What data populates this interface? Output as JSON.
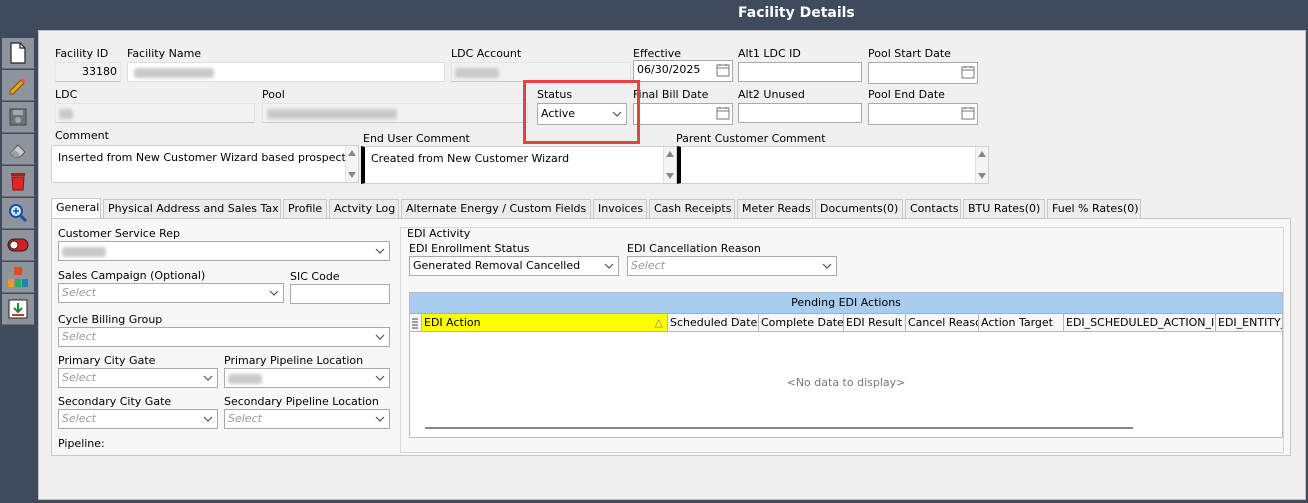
{
  "window": {
    "title": "Facility Details"
  },
  "toolbar": {
    "items": [
      {
        "icon": "new-document-icon"
      },
      {
        "icon": "pencil-icon"
      },
      {
        "icon": "save-icon"
      },
      {
        "icon": "eraser-icon"
      },
      {
        "icon": "delete-icon"
      },
      {
        "icon": "search-zoom-icon"
      },
      {
        "icon": "toggle-icon"
      },
      {
        "icon": "org-chart-icon"
      },
      {
        "icon": "import-icon"
      }
    ]
  },
  "header": {
    "facility_id_label": "Facility ID",
    "facility_id_value": "33180",
    "facility_name_label": "Facility Name",
    "ldc_account_label": "LDC Account",
    "effective_label": "Effective",
    "effective_value": "06/30/2025",
    "alt1_label": "Alt1  LDC ID",
    "pool_start_label": "Pool Start Date",
    "ldc_label": "LDC",
    "pool_label": "Pool",
    "status_label": "Status",
    "status_value": "Active",
    "final_bill_label": "Final Bill Date",
    "alt2_label": "Alt2  Unused",
    "pool_end_label": "Pool End Date",
    "comment_label": "Comment",
    "comment_value": "Inserted from New Customer Wizard based prospect",
    "end_user_comment_label": "End User Comment",
    "end_user_comment_value": "Created from New Customer Wizard",
    "parent_comment_label": "Parent Customer Comment"
  },
  "tabs": [
    "General",
    "Physical Address and Sales Tax",
    "Profile",
    "Actvity Log",
    "Alternate Energy / Custom Fields",
    "Invoices",
    "Cash Receipts",
    "Meter Reads",
    "Documents(0)",
    "Contacts",
    "BTU Rates(0)",
    "Fuel % Rates(0)"
  ],
  "general": {
    "csr_label": "Customer Service Rep",
    "sales_campaign_label": "Sales Campaign (Optional)",
    "sales_campaign_placeholder": "Select",
    "sic_label": "SIC Code",
    "cycle_label": "Cycle Billing Group",
    "cycle_placeholder": "Select",
    "primary_city_gate_label": "Primary City Gate",
    "primary_city_gate_placeholder": "Select",
    "primary_pipeline_label": "Primary Pipeline Location",
    "secondary_city_gate_label": "Secondary City Gate",
    "secondary_city_gate_placeholder": "Select",
    "secondary_pipeline_label": "Secondary Pipeline Location",
    "secondary_pipeline_placeholder": "Select",
    "pipeline_label": "Pipeline:"
  },
  "edi": {
    "group_label": "EDI Activity",
    "enrollment_label": "EDI Enrollment Status",
    "enrollment_value": "Generated Removal Cancelled",
    "cancel_reason_label": "EDI Cancellation Reason",
    "cancel_reason_placeholder": "Select",
    "grid_title": "Pending EDI Actions",
    "columns": [
      "EDI Action",
      "Scheduled Date",
      "Complete Date",
      "EDI Result",
      "Cancel Reaso",
      "Action Target",
      "EDI_SCHEDULED_ACTION_ID",
      "EDI_ENTITY_"
    ],
    "no_data": "<No data to display>"
  },
  "colors": {
    "highlight_box": "#e8413f",
    "selected_column": "#ffff00",
    "grid_title_bg": "#a9cdf1"
  }
}
